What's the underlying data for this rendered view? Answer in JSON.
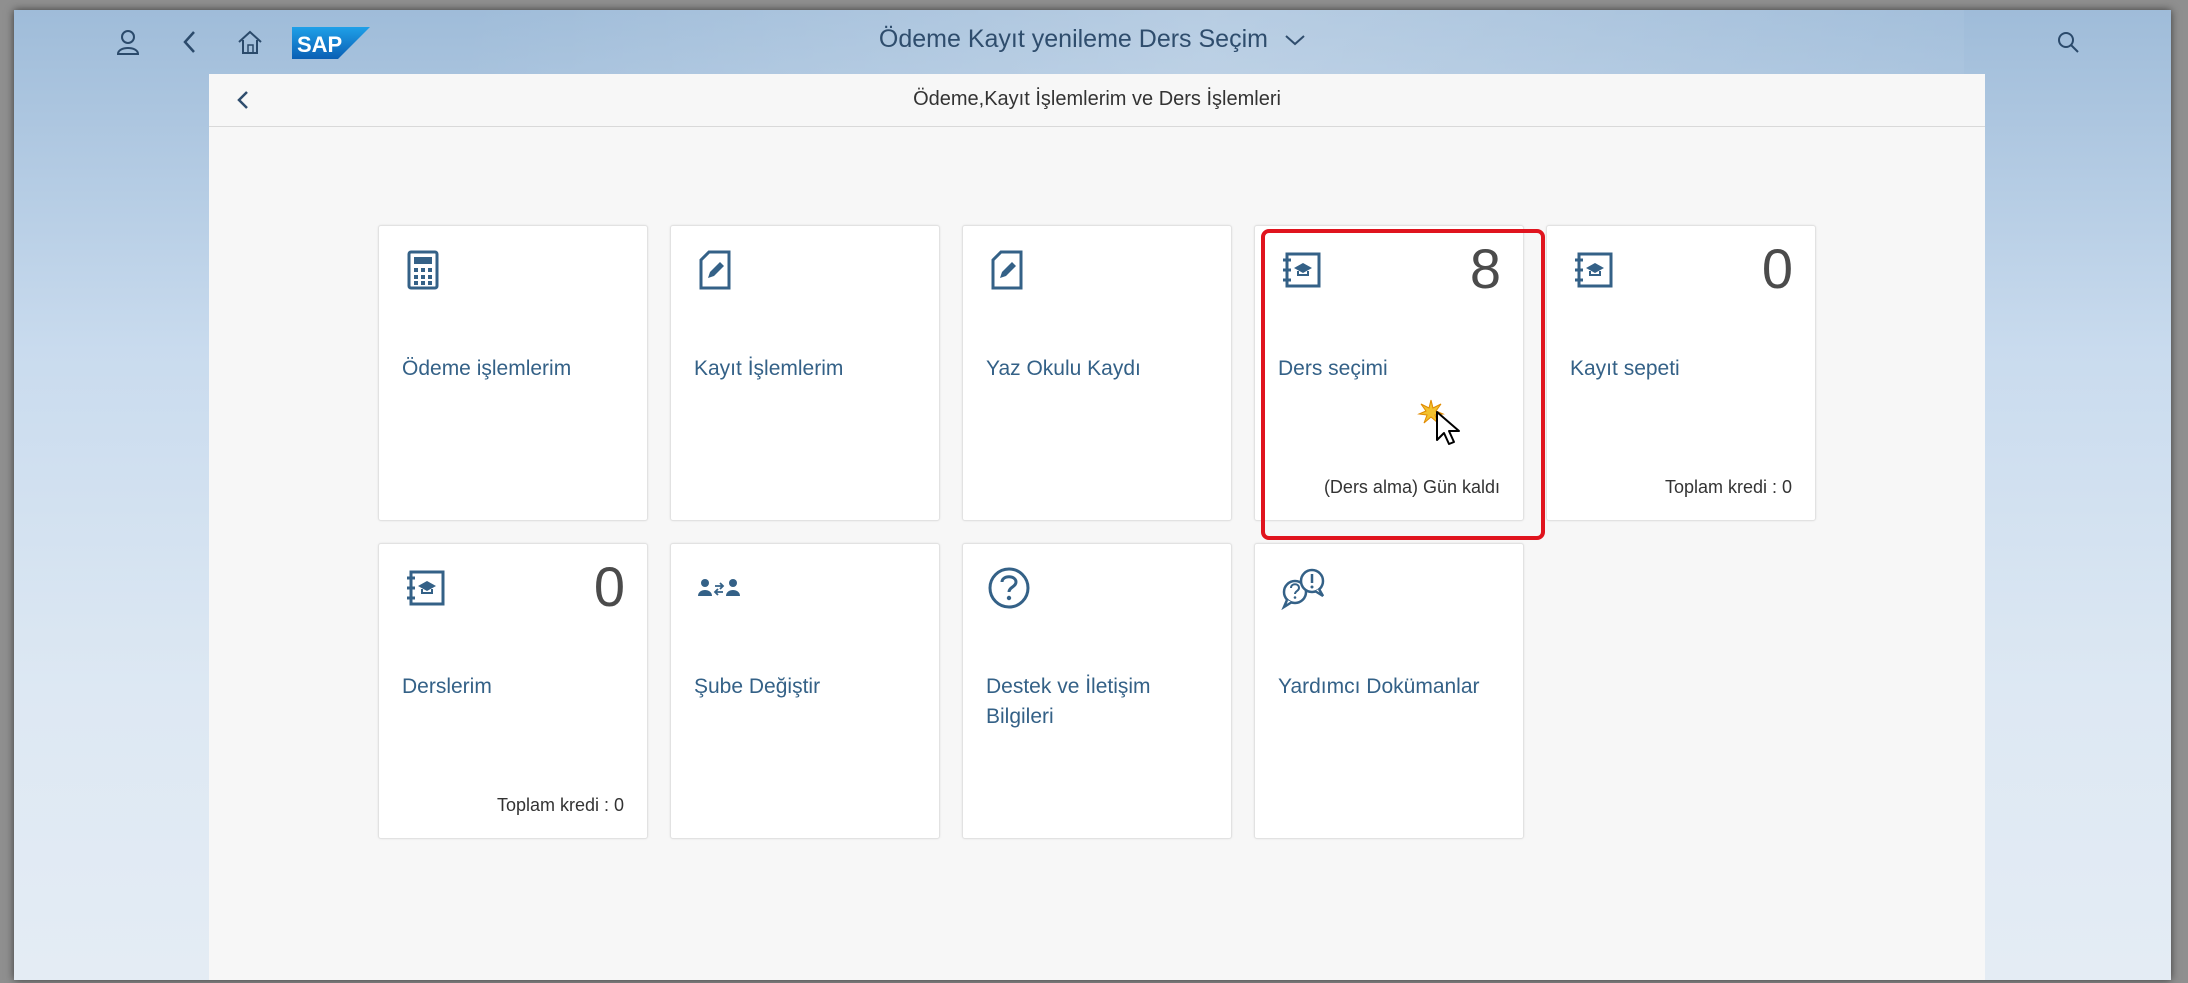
{
  "shell": {
    "title": "Ödeme Kayıt yenileme Ders Seçim",
    "logo_text": "SAP"
  },
  "page": {
    "title": "Ödeme,Kayıt İşlemlerim ve Ders İşlemleri"
  },
  "tiles": [
    {
      "title": "Ödeme işlemlerim",
      "number": "",
      "footer": "",
      "icon": "calculator-icon"
    },
    {
      "title": "Kayıt İşlemlerim",
      "number": "",
      "footer": "",
      "icon": "edit-document-icon"
    },
    {
      "title": "Yaz Okulu Kaydı",
      "number": "",
      "footer": "",
      "icon": "edit-document-icon"
    },
    {
      "title": "Ders seçimi",
      "number": "8",
      "footer": "(Ders alma) Gün kaldı",
      "icon": "course-book-icon"
    },
    {
      "title": "Kayıt sepeti",
      "number": "0",
      "footer": "Toplam kredi : 0",
      "icon": "course-book-icon"
    },
    {
      "title": "Derslerim",
      "number": "0",
      "footer": "Toplam kredi : 0",
      "icon": "course-book-icon"
    },
    {
      "title": "Şube Değiştir",
      "number": "",
      "footer": "",
      "icon": "switch-groups-icon"
    },
    {
      "title": "Destek ve İletişim Bilgileri",
      "number": "",
      "footer": "",
      "icon": "question-icon"
    },
    {
      "title": "Yardımcı Dokümanlar",
      "number": "",
      "footer": "",
      "icon": "discussion-icon"
    }
  ],
  "colors": {
    "accent": "#346187",
    "highlight": "#e0141e",
    "sap_blue": "#1a7dd7"
  }
}
